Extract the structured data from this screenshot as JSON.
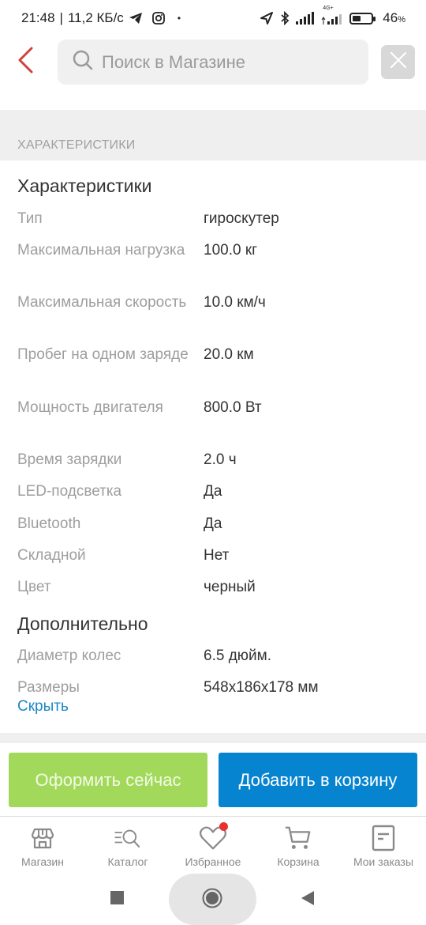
{
  "status_bar": {
    "time": "21:48",
    "separator": "|",
    "speed": "11,2 КБ/с",
    "dot": "•",
    "network_label": "4G+",
    "battery_percent": "46",
    "battery_sign": "%",
    "battery_level": 0.46,
    "icons": [
      "telegram-icon",
      "instagram-icon",
      "location-icon",
      "bluetooth-icon",
      "signal-icon",
      "signal-4g-icon",
      "battery-icon"
    ]
  },
  "header": {
    "back_icon": "chevron-left-icon",
    "search_placeholder": "Поиск в Магазине",
    "search_value": "",
    "close_icon": "close-icon"
  },
  "section": {
    "band_label": "ХАРАКТЕРИСТИКИ"
  },
  "groups": [
    {
      "title": "Характеристики",
      "rows": [
        {
          "label": "Тип",
          "value": "гироскутер"
        },
        {
          "label": "Максимальная нагрузка",
          "value": "100.0 кг"
        },
        {
          "label": "Максимальная скорость",
          "value": "10.0 км/ч"
        },
        {
          "label": "Пробег на одном заряде",
          "value": "20.0 км"
        },
        {
          "label": "Мощность двигателя",
          "value": "800.0 Вт"
        },
        {
          "label": "Время зарядки",
          "value": "2.0 ч"
        },
        {
          "label": "LED-подсветка",
          "value": "Да"
        },
        {
          "label": "Bluetooth",
          "value": "Да"
        },
        {
          "label": "Складной",
          "value": "Нет"
        },
        {
          "label": "Цвет",
          "value": "черный"
        }
      ]
    },
    {
      "title": "Дополнительно",
      "rows": [
        {
          "label": "Диаметр колес",
          "value": "6.5 дюйм."
        },
        {
          "label": "Размеры",
          "value": "548x186x178 мм"
        }
      ]
    }
  ],
  "hide_link": "Скрыть",
  "actions": {
    "buy_now": "Оформить сейчас",
    "add_to_cart": "Добавить в корзину",
    "buy_color": "#a2d95a",
    "cart_color": "#0784d0"
  },
  "bottom_nav": [
    {
      "label": "Магазин",
      "icon": "store-icon"
    },
    {
      "label": "Каталог",
      "icon": "catalog-search-icon"
    },
    {
      "label": "Избранное",
      "icon": "heart-icon",
      "badge": true
    },
    {
      "label": "Корзина",
      "icon": "cart-icon"
    },
    {
      "label": "Мои заказы",
      "icon": "orders-icon"
    }
  ],
  "system_nav": [
    "recents-icon",
    "home-icon",
    "back-triangle-icon"
  ]
}
